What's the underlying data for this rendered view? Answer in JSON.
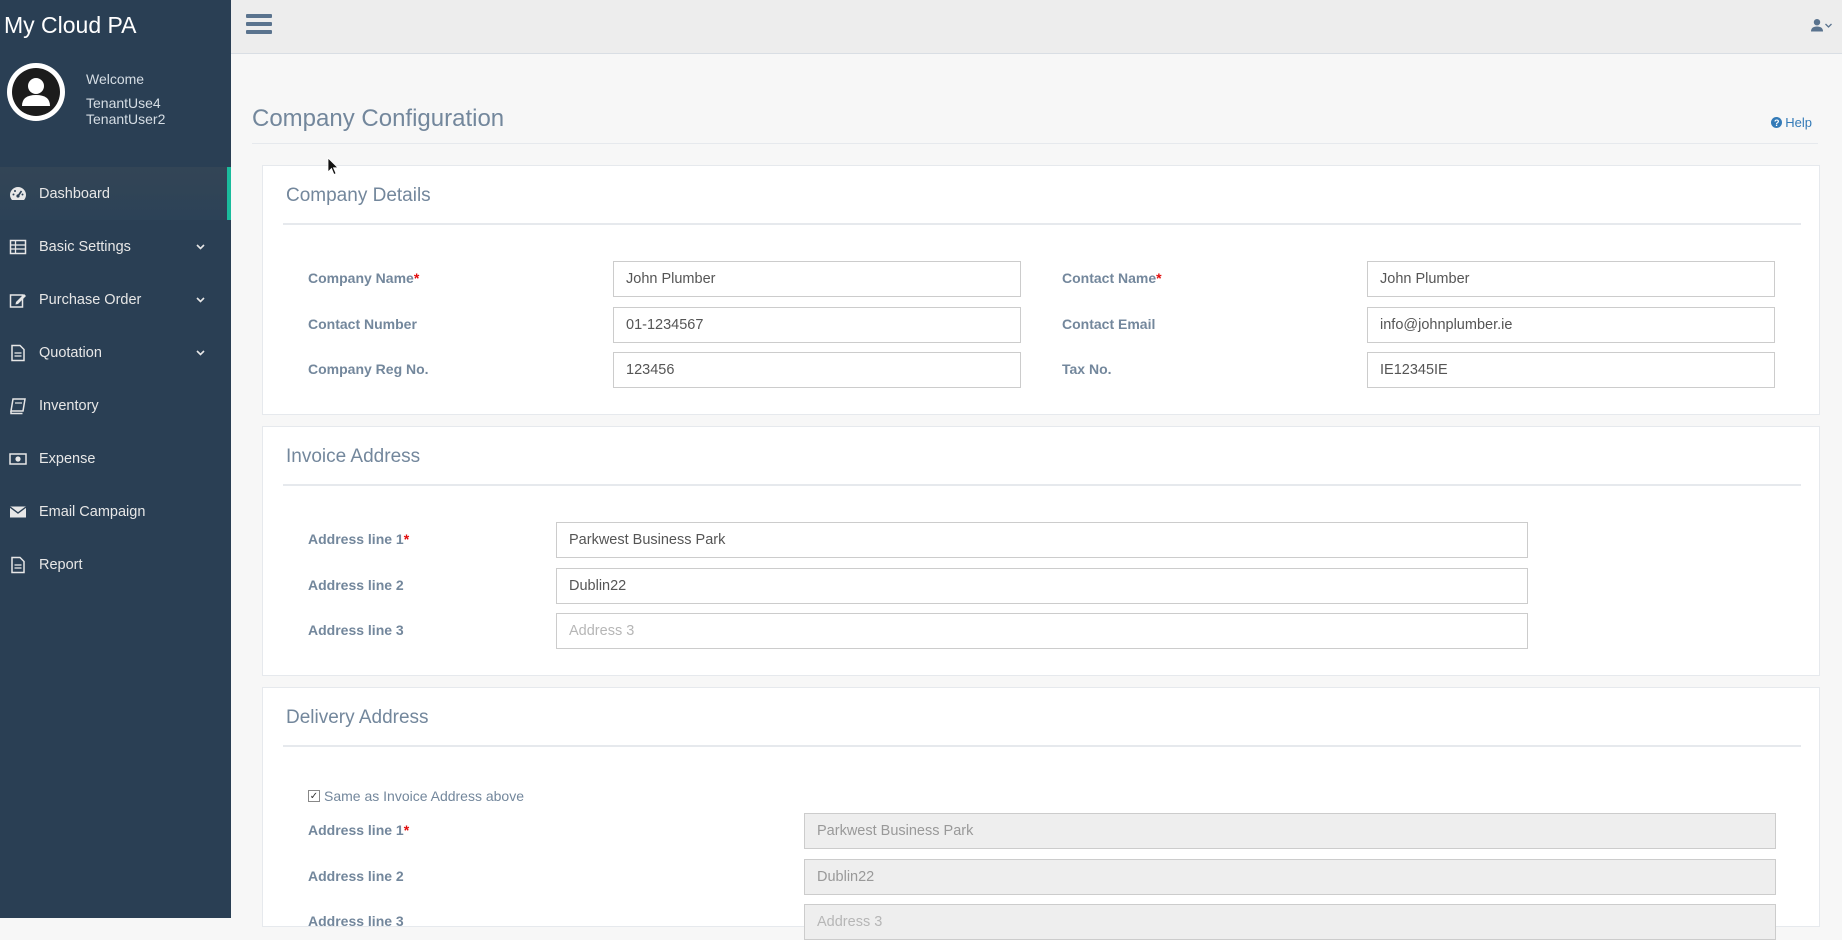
{
  "app": {
    "brand": "My Cloud PA"
  },
  "user": {
    "welcome": "Welcome",
    "line1": "TenantUse4",
    "line2": "TenantUser2"
  },
  "sidebar": {
    "items": [
      {
        "label": "Dashboard",
        "icon": "dashboard-icon",
        "active": true
      },
      {
        "label": "Basic Settings",
        "icon": "table-icon",
        "expandable": true
      },
      {
        "label": "Purchase Order",
        "icon": "edit-icon",
        "expandable": true
      },
      {
        "label": "Quotation",
        "icon": "document-icon",
        "expandable": true
      },
      {
        "label": "Inventory",
        "icon": "book-icon"
      },
      {
        "label": "Expense",
        "icon": "money-icon"
      },
      {
        "label": "Email Campaign",
        "icon": "envelope-icon"
      },
      {
        "label": "Report",
        "icon": "document-icon"
      }
    ]
  },
  "page": {
    "title": "Company Configuration",
    "help": "Help"
  },
  "company_details": {
    "heading": "Company Details",
    "company_name": {
      "label": "Company Name",
      "value": "John Plumber"
    },
    "contact_name": {
      "label": "Contact Name",
      "value": "John Plumber"
    },
    "contact_number": {
      "label": "Contact Number",
      "value": "01-1234567"
    },
    "contact_email": {
      "label": "Contact Email",
      "value": "info@johnplumber.ie"
    },
    "company_reg": {
      "label": "Company Reg No.",
      "value": "123456"
    },
    "tax_no": {
      "label": "Tax No.",
      "value": "IE12345IE"
    },
    "required_marker": "*"
  },
  "invoice_address": {
    "heading": "Invoice Address",
    "line1": {
      "label": "Address line 1",
      "value": "Parkwest Business Park"
    },
    "line2": {
      "label": "Address line 2",
      "value": "Dublin22"
    },
    "line3": {
      "label": "Address line 3",
      "value": "",
      "placeholder": "Address 3"
    }
  },
  "delivery_address": {
    "heading": "Delivery Address",
    "same_as_invoice": {
      "label": "Same as Invoice Address above",
      "checked": true
    },
    "line1": {
      "label": "Address line 1",
      "value": "Parkwest Business Park"
    },
    "line2": {
      "label": "Address line 2",
      "value": "Dublin22"
    },
    "line3": {
      "label": "Address line 3",
      "value": "",
      "placeholder": "Address 3"
    }
  },
  "colors": {
    "sidebar": "#2a3f54",
    "active_accent": "#1abb9c",
    "required": "#e20b0b",
    "link": "#337ab7"
  }
}
